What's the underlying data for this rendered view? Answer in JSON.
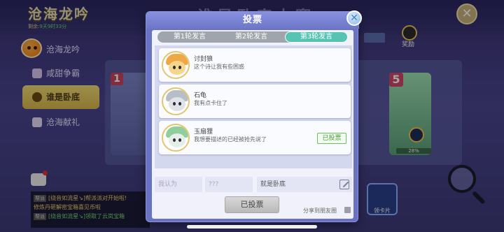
{
  "background": {
    "game_title": "沧海龙吟",
    "countdown_label": "剩余:",
    "countdown_value": "9天9时33分",
    "heading": "谁是卧底大赛",
    "sidebar_items": [
      {
        "label": "沧海龙吟"
      },
      {
        "label": "咸甜争霸"
      },
      {
        "label": "谁是卧底"
      },
      {
        "label": "沧海献礼"
      }
    ],
    "reward_label": "奖励",
    "card_left_num": "1",
    "card_right_num": "5",
    "card_right_pct": "28%",
    "card_button_label": "领卡片",
    "chat": [
      {
        "tag": "帮派",
        "text": "[绕音如流星↘]帮派派对开始啦!"
      },
      {
        "tag": "",
        "text": "修炼丹砸解密宝箱喜见币啦"
      },
      {
        "tag": "帮派",
        "text": "[绕音如流星↘]领取了云岚宝箱"
      }
    ],
    "close_label": "✕"
  },
  "modal": {
    "title": "投票",
    "close_label": "✕",
    "tabs": [
      {
        "label": "第1轮发言",
        "active": false
      },
      {
        "label": "第2轮发言",
        "active": false
      },
      {
        "label": "第3轮发言",
        "active": true
      }
    ],
    "entries": [
      {
        "name": "讨封狼",
        "message": "这个诗让我有些困惑",
        "voted": false
      },
      {
        "name": "石龟",
        "message": "我有点卡住了",
        "voted": false
      },
      {
        "name": "玉扇狸",
        "message": "我想要描述的已经被抢先说了",
        "voted": true,
        "badge": "已投票"
      }
    ],
    "input_1_placeholder": "我认为",
    "input_2_placeholder": "???",
    "input_3_value": "就是卧底",
    "submit_label": "已投票",
    "share_label": "分享到朋友圈"
  },
  "colors": {
    "modal_bg": "#6a72c2",
    "tab_active": "#57c4b3",
    "voted_green": "#4a9d3a",
    "sidebar_active": "#e7c95f"
  },
  "icons": [
    "mascot-icon",
    "close-icon",
    "edit-icon",
    "magnifier-icon",
    "chat-icon",
    "share-checkbox-icon"
  ]
}
